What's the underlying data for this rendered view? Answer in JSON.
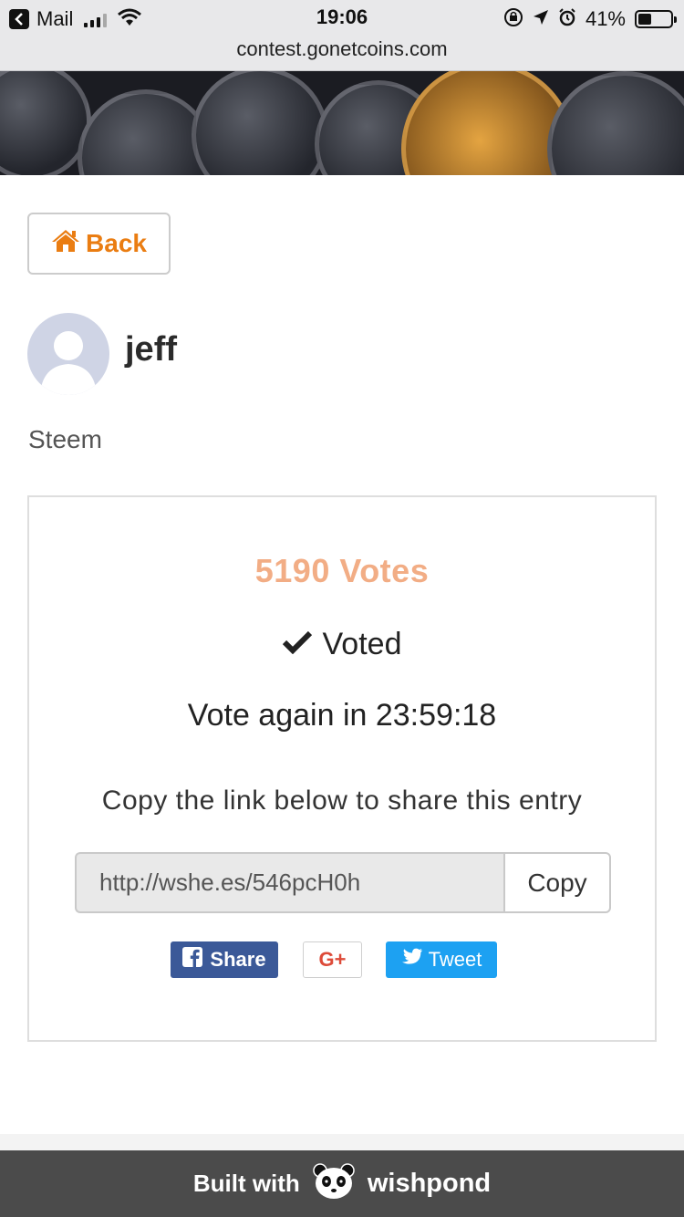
{
  "status_bar": {
    "back_app": "Mail",
    "time": "19:06",
    "battery_percent": "41%",
    "battery_level": 0.41,
    "signal_bars_active": 3
  },
  "browser": {
    "url": "contest.gonetcoins.com"
  },
  "page": {
    "back_label": "Back",
    "entry_name": "jeff",
    "entry_description": "Steem"
  },
  "vote": {
    "count_text": "5190 Votes",
    "voted_label": "Voted",
    "vote_again_text": "Vote again in 23:59:18",
    "share_hint": "Copy the link below to share this entry",
    "share_link": "http://wshe.es/546pcH0h",
    "copy_label": "Copy"
  },
  "social": {
    "facebook_label": "Share",
    "google_label": "G+",
    "twitter_label": "Tweet"
  },
  "footer": {
    "built_with": "Built with",
    "brand": "wishpond"
  },
  "colors": {
    "accent_orange": "#ea7d12",
    "votes_color": "#f2ad85",
    "facebook_blue": "#3b5998",
    "twitter_blue": "#1da1f2",
    "footer_bg": "#4b4b4b"
  }
}
